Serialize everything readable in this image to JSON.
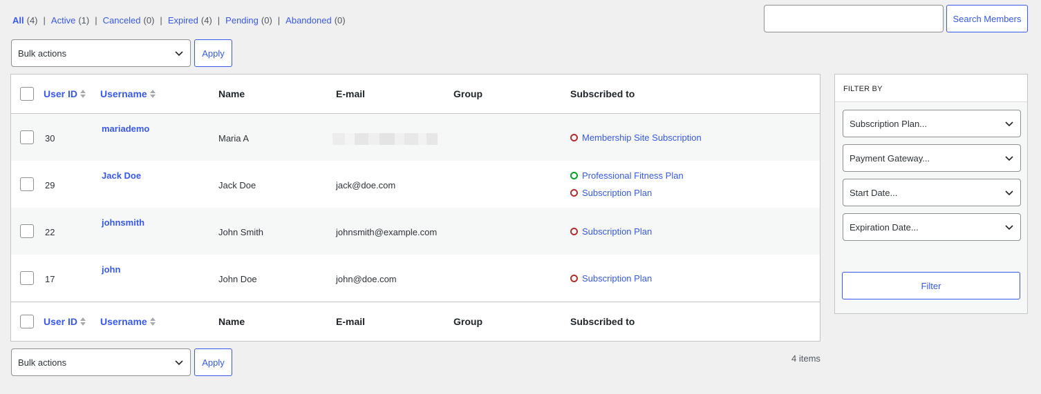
{
  "status_filters": [
    {
      "label": "All",
      "count": "(4)"
    },
    {
      "label": "Active",
      "count": "(1)"
    },
    {
      "label": "Canceled",
      "count": "(0)"
    },
    {
      "label": "Expired",
      "count": "(4)"
    },
    {
      "label": "Pending",
      "count": "(0)"
    },
    {
      "label": "Abandoned",
      "count": "(0)"
    }
  ],
  "search": {
    "value": "",
    "button_label": "Search Members"
  },
  "bulk": {
    "select_label": "Bulk actions",
    "apply_label": "Apply"
  },
  "columns": {
    "user_id": "User ID",
    "username": "Username",
    "name": "Name",
    "email": "E-mail",
    "group": "Group",
    "subscribed_to": "Subscribed to"
  },
  "rows": [
    {
      "user_id": "30",
      "username": "mariademo",
      "name": "Maria A",
      "email": "",
      "email_redacted": true,
      "subscriptions": [
        {
          "label": "Membership Site Subscription",
          "status": "inactive"
        }
      ]
    },
    {
      "user_id": "29",
      "username": "Jack Doe",
      "name": "Jack Doe",
      "email": "jack@doe.com",
      "subscriptions": [
        {
          "label": "Professional Fitness Plan",
          "status": "active"
        },
        {
          "label": "Subscription Plan",
          "status": "inactive"
        }
      ]
    },
    {
      "user_id": "22",
      "username": "johnsmith",
      "name": "John Smith",
      "email": "johnsmith@example.com",
      "subscriptions": [
        {
          "label": "Subscription Plan",
          "status": "inactive"
        }
      ]
    },
    {
      "user_id": "17",
      "username": "john",
      "name": "John Doe",
      "email": "john@doe.com",
      "subscriptions": [
        {
          "label": "Subscription Plan",
          "status": "inactive"
        }
      ]
    }
  ],
  "items_count": "4 items",
  "filter_panel": {
    "title": "FILTER BY",
    "selects": [
      "Subscription Plan...",
      "Payment Gateway...",
      "Start Date...",
      "Expiration Date..."
    ],
    "button_label": "Filter"
  },
  "colors": {
    "link": "#3858e9",
    "active_dot": "#00a32a",
    "inactive_dot": "#b32d2e",
    "alt_row": "#f6f7f7"
  },
  "icons": {
    "sort": "sort-icon",
    "dropdown": "chevron-down-icon",
    "status": "status-dot-icon"
  }
}
